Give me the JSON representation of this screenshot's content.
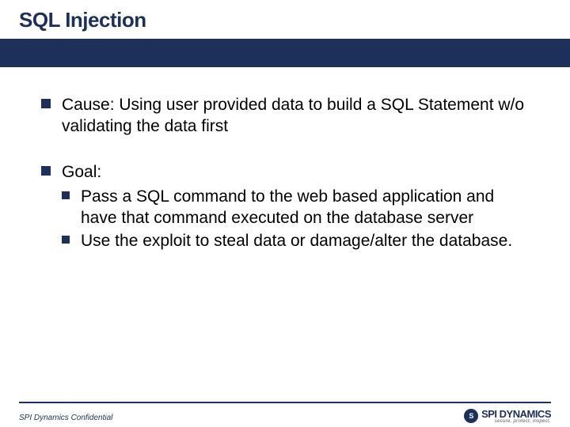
{
  "title": "SQL Injection",
  "bullets": [
    {
      "text": "Cause: Using user provided data to build a SQL Statement w/o validating the data first",
      "sub": []
    },
    {
      "text": "Goal:",
      "sub": [
        "Pass a SQL command to the web based application and have that command executed on the database server",
        "Use the exploit to steal data or damage/alter the database."
      ]
    }
  ],
  "footer": "SPI Dynamics Confidential",
  "logo": {
    "mark": "S",
    "main": "SPI DYNAMICS",
    "sub": "secure. protect. inspect."
  }
}
